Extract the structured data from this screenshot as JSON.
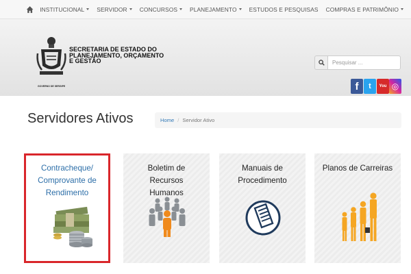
{
  "topnav": {
    "home_icon": "home-icon",
    "items": [
      {
        "label": "INSTITUCIONAL",
        "dropdown": true
      },
      {
        "label": "SERVIDOR",
        "dropdown": true
      },
      {
        "label": "CONCURSOS",
        "dropdown": true
      },
      {
        "label": "PLANEJAMENTO",
        "dropdown": true
      },
      {
        "label": "ESTUDOS E PESQUISAS",
        "dropdown": false
      },
      {
        "label": "COMPRAS E PATRIMÔNIO",
        "dropdown": true
      }
    ]
  },
  "header": {
    "logo_caption": "GOVERNO DE SERGIPE",
    "org_name_lines": [
      "SECRETARIA DE ESTADO DO",
      "PLANEJAMENTO, ORÇAMENTO",
      "E GESTÃO"
    ],
    "search": {
      "placeholder": "Pesquisar ...",
      "icon": "search-icon"
    },
    "social": [
      {
        "name": "facebook-icon",
        "glyph": "f",
        "color": "#3b5998"
      },
      {
        "name": "twitter-icon",
        "glyph": "t",
        "color": "#2aa3ef"
      },
      {
        "name": "youtube-icon",
        "glyph": "You",
        "color": "#d62a2a"
      },
      {
        "name": "instagram-icon",
        "glyph": "◎",
        "color": "#c43b8c"
      }
    ]
  },
  "page": {
    "title": "Servidores Ativos",
    "breadcrumb": {
      "home": "Home",
      "current": "Servidor Ativo"
    }
  },
  "cards": [
    {
      "lines": [
        "Contracheque/",
        "Comprovante de",
        "Rendimento"
      ],
      "icon": "money-coins-icon",
      "selected": true
    },
    {
      "lines": [
        "Boletim de Recursos",
        "Humanos"
      ],
      "icon": "people-group-icon",
      "selected": false
    },
    {
      "lines": [
        "Manuais de",
        "Procedimento"
      ],
      "icon": "document-manual-icon",
      "selected": false
    },
    {
      "lines": [
        "Planos de Carreiras"
      ],
      "icon": "career-growth-icon",
      "selected": false
    }
  ],
  "colors": {
    "selected_border": "#d9262b",
    "link": "#337ab7",
    "accent_orange": "#f08a1c"
  }
}
